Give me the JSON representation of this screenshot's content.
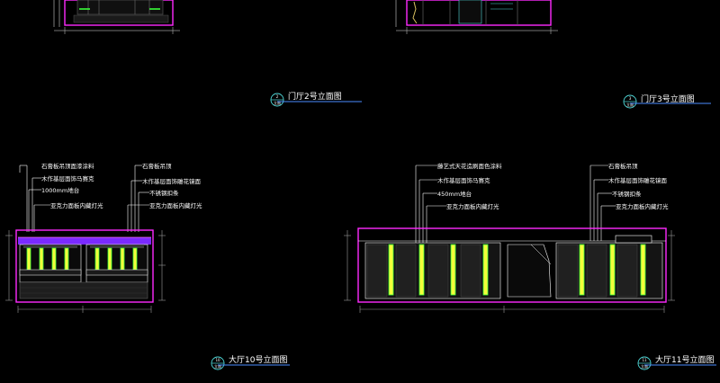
{
  "drawing_titles": {
    "door_hall_2": "门厅2号立面图",
    "door_hall_3": "门厅3号立面图",
    "hall_10": "大厅10号立面图",
    "hall_11": "大厅11号立面图"
  },
  "title_badges": {
    "door_hall_2": {
      "number": "2",
      "sub": "立面"
    },
    "door_hall_3": {
      "number": "3",
      "sub": "立面"
    },
    "hall_10": {
      "number": "10",
      "sub": "立面"
    },
    "hall_11": {
      "number": "11",
      "sub": "立面"
    }
  },
  "hall10_annotations_left": [
    "石膏板吊顶面漆涂料",
    "木作基层面饰马赛克",
    "1000mm地台",
    "亚克力面板内藏灯光"
  ],
  "hall10_annotations_right": [
    "石膏板吊顶",
    "木作基层面饰雕花镜面",
    "不锈钢扣条",
    "亚克力面板内藏灯光"
  ],
  "hall11_annotations_left": [
    "藤艺式天花造刷面色涂料",
    "木作基层面饰马赛克",
    "450mm地台",
    "亚克力面板内藏灯光"
  ],
  "hall11_annotations_right": [
    "石膏板吊顶",
    "木作基层面饰雕花镜面",
    "不锈钢扣条",
    "亚克力面板内藏灯光"
  ],
  "colors": {
    "background": "#000000",
    "title_underline": "#4a8bff",
    "frame": "#ff2aff",
    "light_strip": "#f2ff3a",
    "glow": "#3aff3a",
    "dimension": "#9a9a9a",
    "leader": "#ffffff",
    "panel_dark": "#1a1a1a"
  }
}
